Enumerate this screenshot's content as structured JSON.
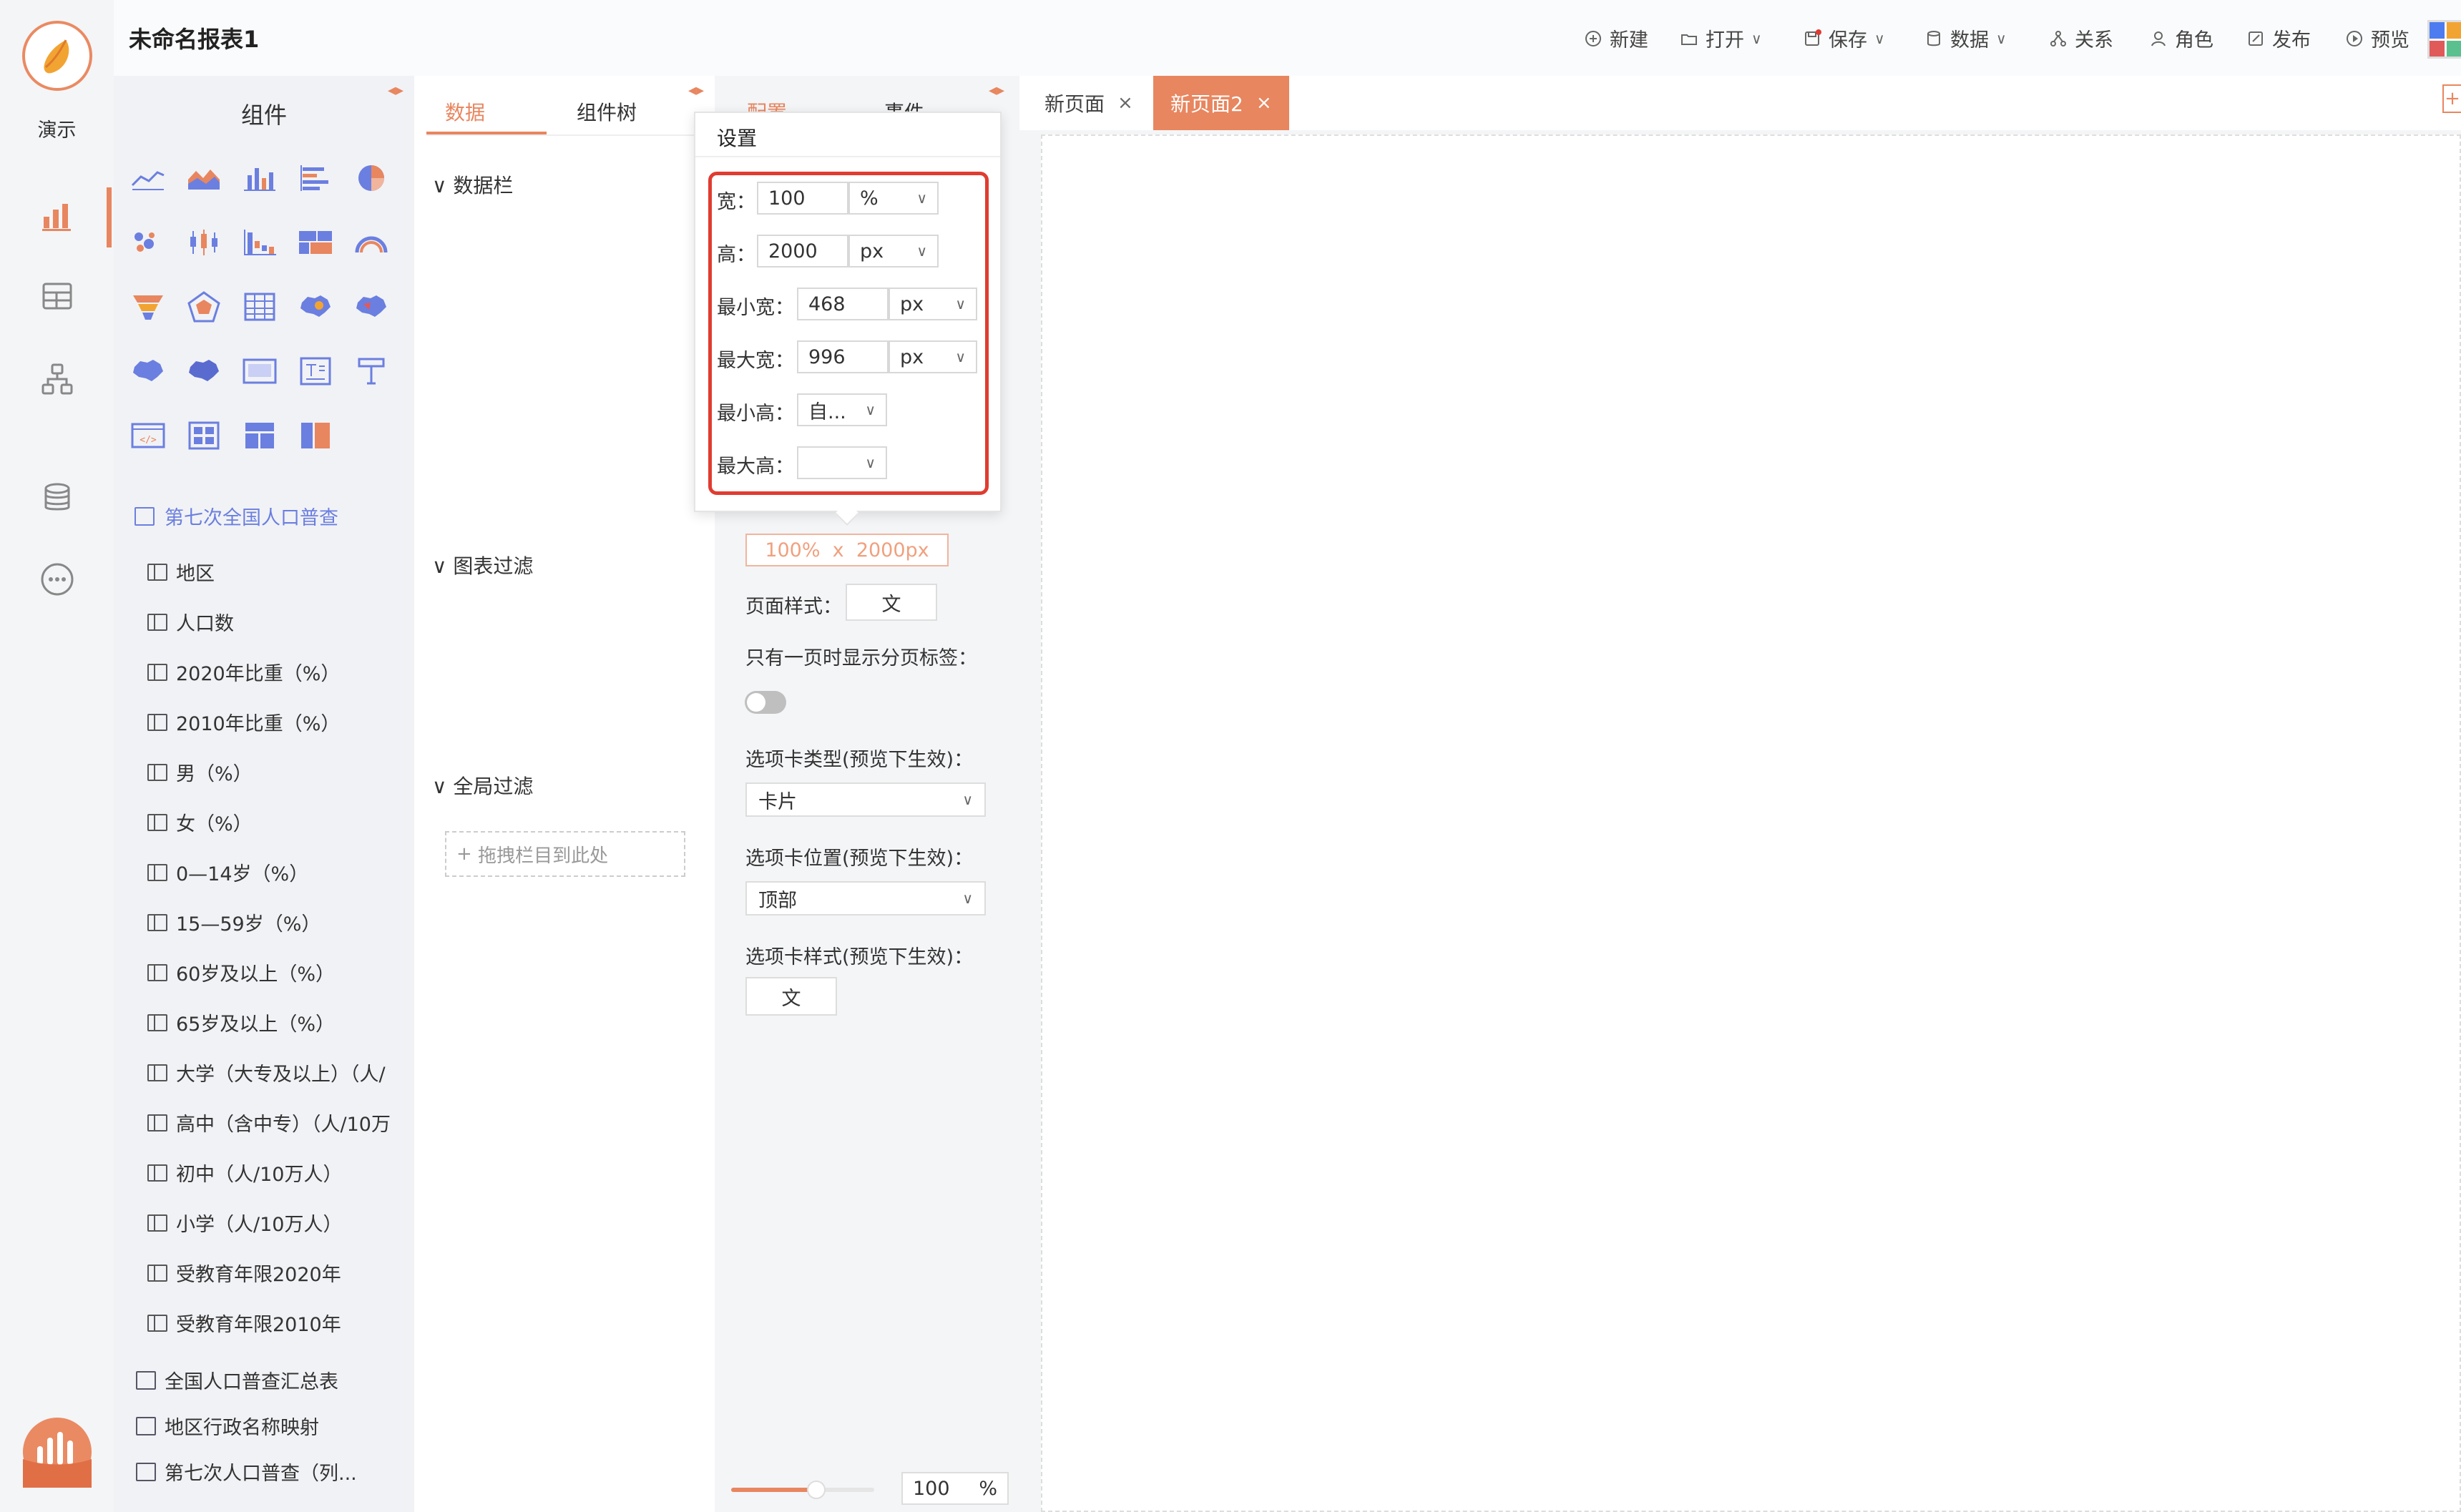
{
  "app": {
    "title": "未命名报表1",
    "mode_label": "演示"
  },
  "toolbar": {
    "items": [
      {
        "label": "新建",
        "icon": "plus-circle-icon"
      },
      {
        "label": "打开",
        "icon": "folder-open-icon"
      },
      {
        "label": "保存",
        "icon": "save-icon"
      },
      {
        "label": "数据",
        "icon": "database-icon"
      },
      {
        "label": "关系",
        "icon": "relation-icon"
      },
      {
        "label": "角色",
        "icon": "user-icon"
      },
      {
        "label": "发布",
        "icon": "publish-icon"
      },
      {
        "label": "预览",
        "icon": "play-icon"
      }
    ],
    "caret": "∨"
  },
  "components_panel": {
    "title": "组件"
  },
  "datasource": {
    "main": "第七次全国人口普查",
    "fields": [
      "地区",
      "人口数",
      "2020年比重（%）",
      "2010年比重（%）",
      "男（%）",
      "女（%）",
      "0—14岁（%）",
      "15—59岁（%）",
      "60岁及以上（%）",
      "65岁及以上（%）",
      "大学（大专及以上）（人/",
      "高中（含中专）（人/10万",
      "初中（人/10万人）",
      "小学（人/10万人）",
      "受教育年限2020年",
      "受教育年限2010年"
    ],
    "others": [
      "全国人口普查汇总表",
      "地区行政名称映射",
      "第七次人口普查（列..."
    ]
  },
  "data_panel": {
    "tabs": [
      "数据",
      "组件树"
    ],
    "sections": [
      "数据栏",
      "图表过滤",
      "全局过滤"
    ],
    "dropzone": "拖拽栏目到此处"
  },
  "config_panel": {
    "tabs": [
      "配置",
      "事件"
    ],
    "size_display": "100%  x  2000px",
    "page_style_label": "页面样式：",
    "style_btn": "文",
    "single_page_tab_label": "只有一页时显示分页标签：",
    "tab_type_label": "选项卡类型(预览下生效)：",
    "tab_type_value": "卡片",
    "tab_position_label": "选项卡位置(预览下生效)：",
    "tab_position_value": "顶部",
    "tab_style_label": "选项卡样式(预览下生效)：",
    "tab_style_btn": "文",
    "zoom_value": "100",
    "zoom_unit": "%"
  },
  "settings_popup": {
    "title": "设置",
    "rows": [
      {
        "label": "宽：",
        "value": "100",
        "unit": "%"
      },
      {
        "label": "高：",
        "value": "2000",
        "unit": "px"
      },
      {
        "label": "最小宽：",
        "value": "468",
        "unit": "px"
      },
      {
        "label": "最大宽：",
        "value": "996",
        "unit": "px"
      },
      {
        "label": "最小高：",
        "value": "",
        "unit": "自..."
      },
      {
        "label": "最大高：",
        "value": "",
        "unit": ""
      }
    ]
  },
  "page_tabs": [
    {
      "label": "新页面",
      "active": false
    },
    {
      "label": "新页面2",
      "active": true
    }
  ],
  "colors": {
    "accent": "#e8865f",
    "blue": "#6b7fe0",
    "red_frame": "#e03c31"
  }
}
